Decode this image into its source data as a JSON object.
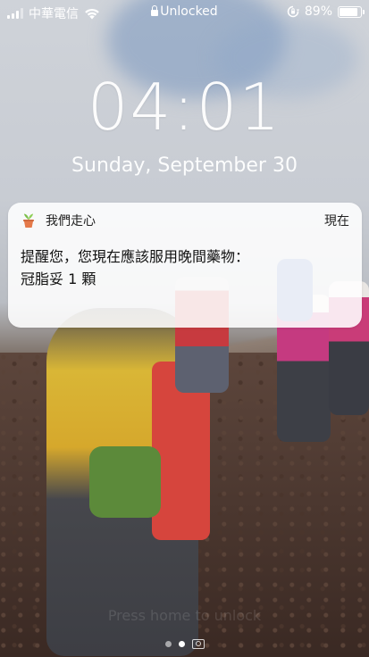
{
  "status_bar": {
    "carrier": "中華電信",
    "lock_status": "Unlocked",
    "battery_percent": "89%",
    "battery_level": 0.89,
    "icons": [
      "signal-icon",
      "wifi-icon",
      "padlock-icon",
      "orientation-lock-icon",
      "battery-icon"
    ]
  },
  "lock_screen": {
    "time": "04:01",
    "date": "Sunday, September 30"
  },
  "notification": {
    "app_name": "我們走心",
    "time": "現在",
    "message_line1": "提醒您，您現在應該服用晚間藥物：",
    "message_line2": "冠脂妥 1 顆",
    "icon": "potted-plant-icon"
  },
  "bottom": {
    "hint": "Press home to unlock",
    "page_count": 2,
    "active_page": 2,
    "camera_icon": "camera-icon"
  },
  "colors": {
    "notification_bg": "#ffffff",
    "text_dark": "#111111",
    "plant_green": "#7bbf4a",
    "pot_orange": "#e57a4a"
  }
}
